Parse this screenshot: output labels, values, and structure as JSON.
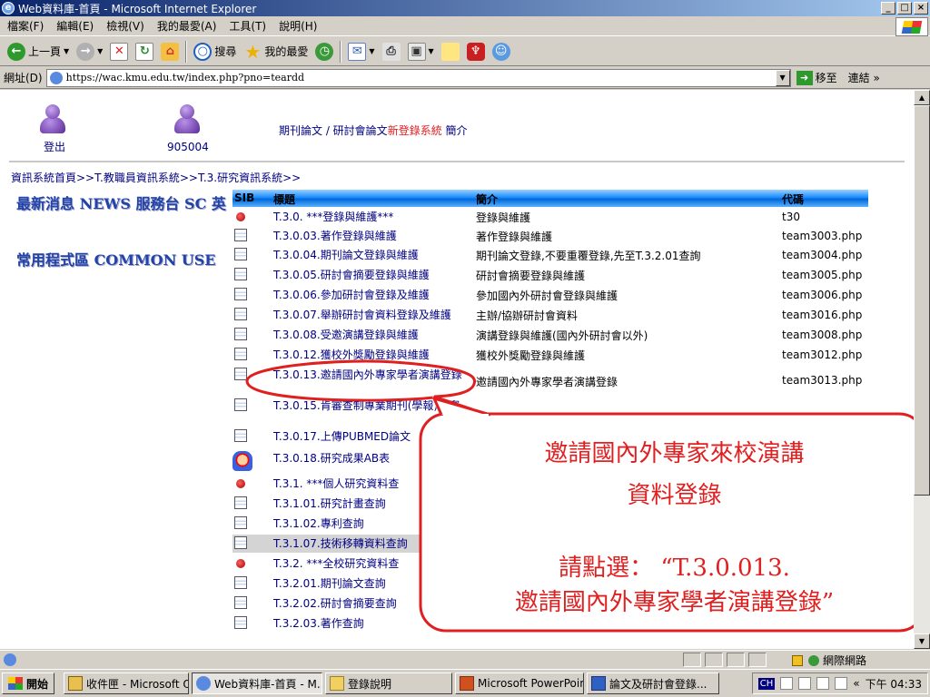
{
  "window": {
    "title": "Web資料庫-首頁 - Microsoft Internet Explorer",
    "min": "_",
    "max": "□",
    "close": "×"
  },
  "menu": [
    "檔案(F)",
    "編輯(E)",
    "檢視(V)",
    "我的最愛(A)",
    "工具(T)",
    "說明(H)"
  ],
  "toolbar": {
    "back": "上一頁",
    "search": "搜尋",
    "favorites": "我的最愛"
  },
  "address": {
    "label": "網址(D)",
    "url": "https://wac.kmu.edu.tw/index.php?pno=teardd",
    "go": "移至",
    "links": "連結 »"
  },
  "page": {
    "logout": "登出",
    "user_id": "905004",
    "title_prefix": "期刊論文 / 研討會論文",
    "title_red": "新登錄系統",
    "title_suffix": " 簡介",
    "breadcrumb": "資訊系統首頁>>T.教職員資訊系統>>T.3.研究資訊系統>>",
    "news": "最新消息 NEWS  服務台 SC  英",
    "common": "常用程式區 COMMON USE"
  },
  "table": {
    "headers": [
      "SIB",
      "標題",
      "簡介",
      "代碼"
    ],
    "rows": [
      {
        "icon": "bullet",
        "title": "T.3.0. ***登錄與維護***",
        "desc": "登錄與維護",
        "code": "t30"
      },
      {
        "icon": "doc",
        "title": "T.3.0.03.著作登錄與維護",
        "desc": "著作登錄與維護",
        "code": "team3003.php"
      },
      {
        "icon": "doc",
        "title": "T.3.0.04.期刊論文登錄與維護",
        "desc": "期刊論文登錄,不要重覆登錄,先至T.3.2.01查詢",
        "code": "team3004.php"
      },
      {
        "icon": "doc",
        "title": "T.3.0.05.研討會摘要登錄與維護",
        "desc": "研討會摘要登錄與維護",
        "code": "team3005.php"
      },
      {
        "icon": "doc",
        "title": "T.3.0.06.參加研討會登錄及維護",
        "desc": "參加國內外研討會登錄與維護",
        "code": "team3006.php"
      },
      {
        "icon": "doc",
        "title": "T.3.0.07.舉辦研討會資料登錄及維護",
        "desc": "主辦/協辦研討會資料",
        "code": "team3016.php"
      },
      {
        "icon": "doc",
        "title": "T.3.0.08.受邀演講登錄與維護",
        "desc": "演講登錄與維護(國內外研討會以外)",
        "code": "team3008.php"
      },
      {
        "icon": "doc",
        "title": "T.3.0.12.獲校外獎勵登錄與維護",
        "desc": "獲校外獎勵登錄與維護",
        "code": "team3012.php"
      },
      {
        "icon": "doc",
        "title": "T.3.0.13.邀請國內外專家學者演講登錄",
        "desc": "邀請國內外專家學者演講登錄",
        "code": "team3013.php"
      },
      {
        "icon": "doc",
        "title": "T.3.0.15.肯審查制專業期刊(學報)編審",
        "desc": "",
        "code": ""
      },
      {
        "icon": "doc",
        "title": "T.3.0.17.上傳PUBMED論文",
        "desc": "",
        "code": ""
      },
      {
        "icon": "clown",
        "title": "T.3.0.18.研究成果AB表",
        "desc": "",
        "code": ""
      },
      {
        "icon": "bullet",
        "title": "T.3.1. ***個人研究資料查",
        "desc": "",
        "code": ""
      },
      {
        "icon": "doc",
        "title": "T.3.1.01.研究計畫查詢",
        "desc": "",
        "code": ""
      },
      {
        "icon": "doc",
        "title": "T.3.1.02.專利查詢",
        "desc": "",
        "code": ""
      },
      {
        "icon": "doc",
        "title": "T.3.1.07.技術移轉資料查詢",
        "desc": "",
        "code": ""
      },
      {
        "icon": "bullet",
        "title": "T.3.2. ***全校研究資料查",
        "desc": "",
        "code": ""
      },
      {
        "icon": "doc",
        "title": "T.3.2.01.期刊論文查詢",
        "desc": "",
        "code": ""
      },
      {
        "icon": "doc",
        "title": "T.3.2.02.研討會摘要查詢",
        "desc": "",
        "code": ""
      },
      {
        "icon": "doc",
        "title": "T.3.2.03.著作查詢",
        "desc": "",
        "code": ""
      }
    ]
  },
  "callout": {
    "line1": "邀請國內外專家來校演講",
    "line2": "資料登錄",
    "line3": "請點選： “T.3.0.013.",
    "line4": "邀請國內外專家學者演講登錄”",
    "color": "#e02020"
  },
  "status": {
    "zone": "網際網路"
  },
  "taskbar": {
    "start": "開始",
    "tasks": [
      "收件匣 - Microsoft O...",
      "Web資料庫-首頁 - M...",
      "登錄說明",
      "Microsoft PowerPoint ...",
      "論文及研討會登錄..."
    ],
    "tray_ch": "CH",
    "collapse": "«",
    "clock": "下午 04:33"
  }
}
